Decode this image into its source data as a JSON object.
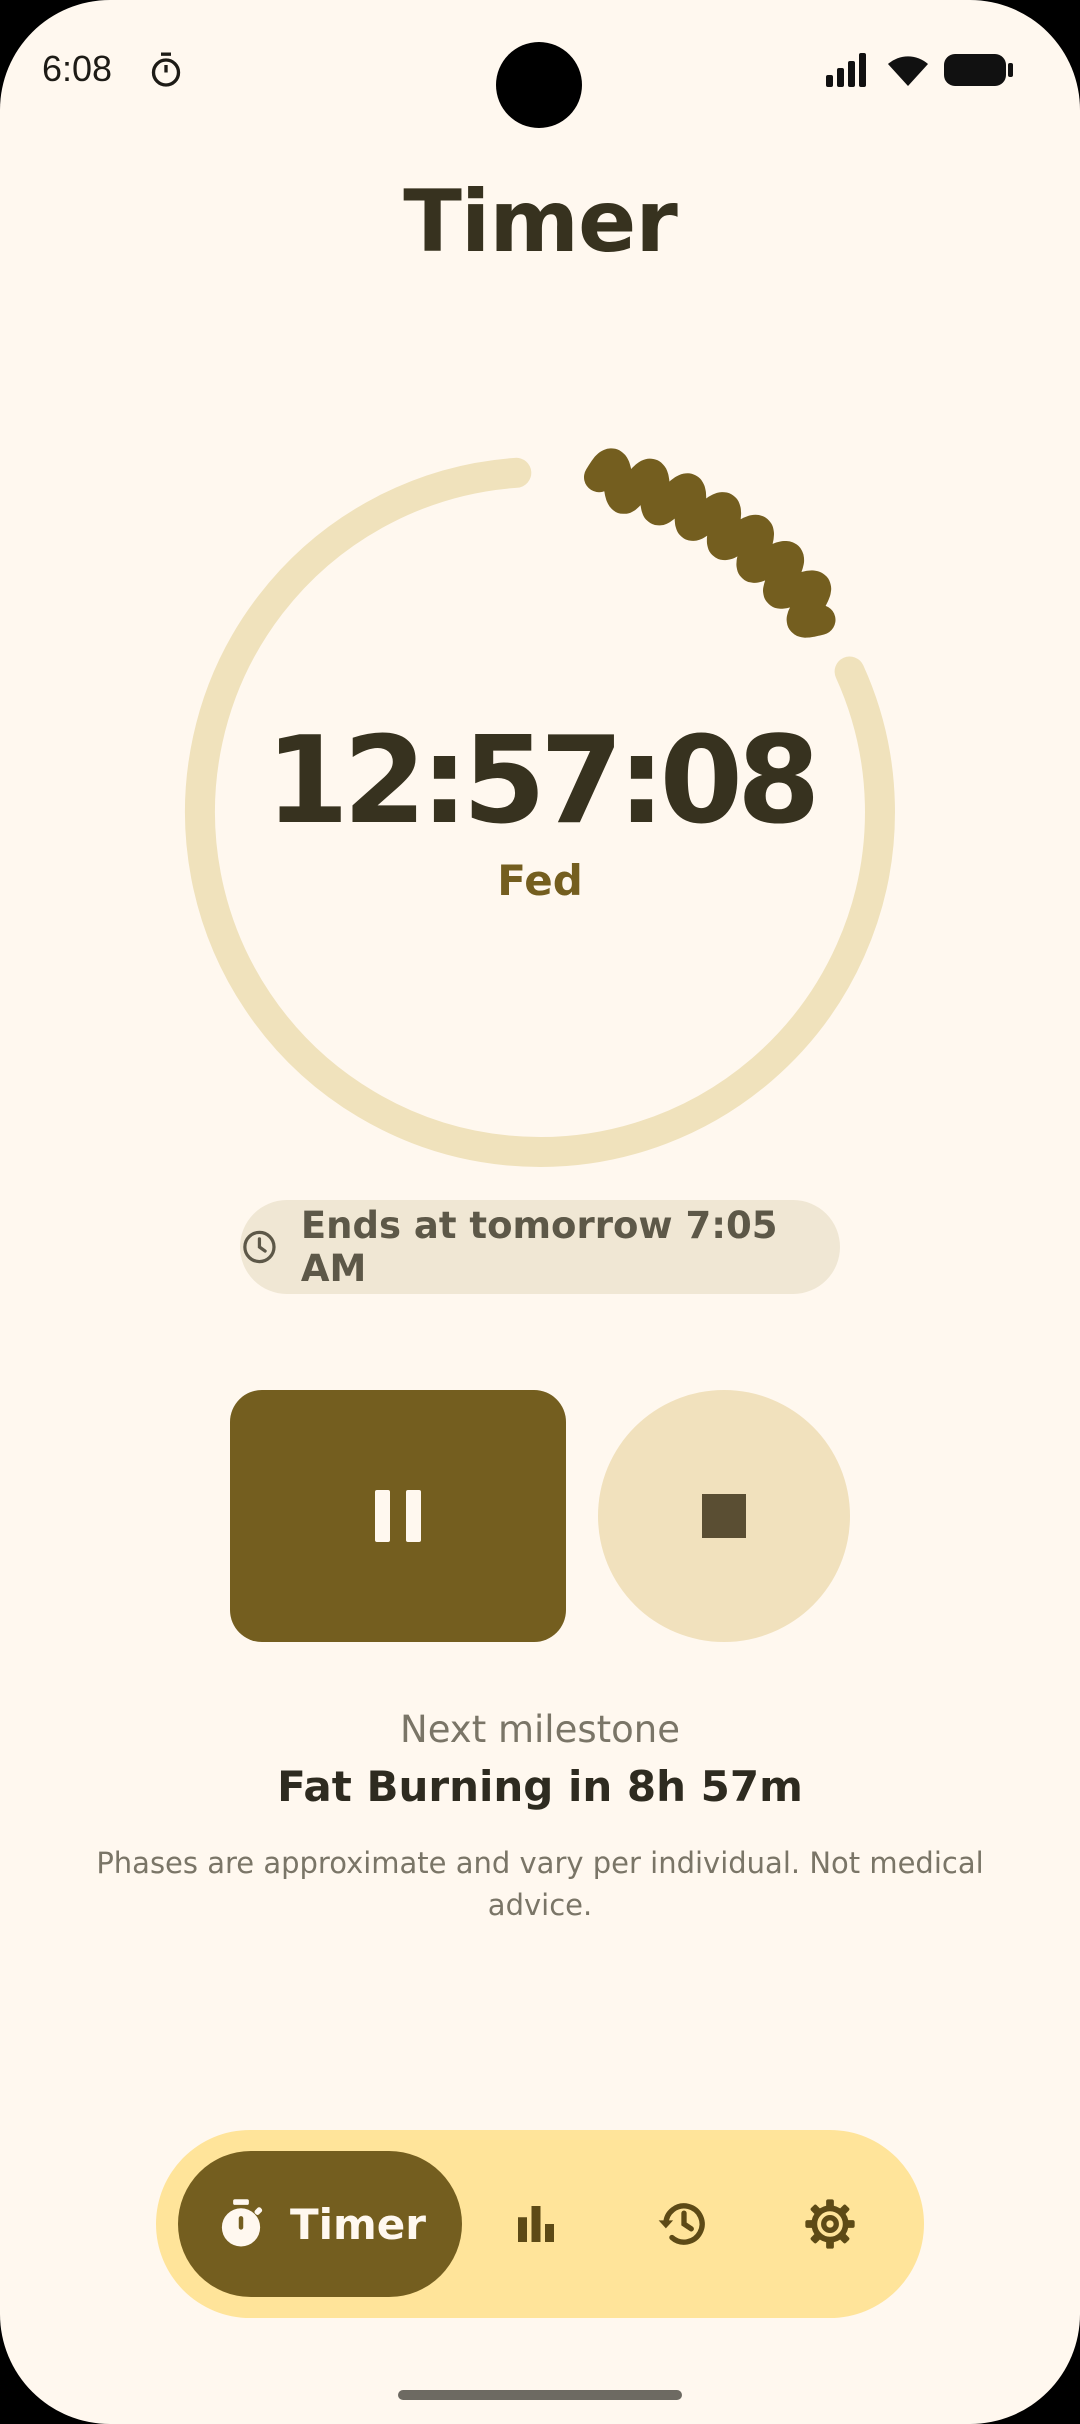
{
  "status_bar": {
    "time": "6:08"
  },
  "header": {
    "title": "Timer"
  },
  "timer": {
    "elapsed": "12:57:08",
    "phase": "Fed",
    "progress_fraction": 0.16,
    "colors": {
      "track": "#F0E2BC",
      "progress": "#745e1f"
    }
  },
  "ends_chip": {
    "icon": "clock-icon",
    "text": "Ends at tomorrow 7:05 AM"
  },
  "controls": {
    "pause_icon": "pause-icon",
    "stop_icon": "stop-icon"
  },
  "milestone": {
    "label": "Next milestone",
    "value": "Fat Burning in 8h 57m",
    "disclaimer": "Phases are approximate and vary per individual. Not medical advice."
  },
  "nav": {
    "items": [
      {
        "id": "timer",
        "label": "Timer",
        "icon": "stopwatch-icon",
        "active": true
      },
      {
        "id": "stats",
        "icon": "bar-chart-icon",
        "active": false
      },
      {
        "id": "history",
        "icon": "history-icon",
        "active": false
      },
      {
        "id": "settings",
        "icon": "gear-icon",
        "active": false
      }
    ]
  },
  "theme": {
    "accent": "#745e1f",
    "background": "#FFF8EF",
    "nav_bg": "#FFE49A"
  }
}
